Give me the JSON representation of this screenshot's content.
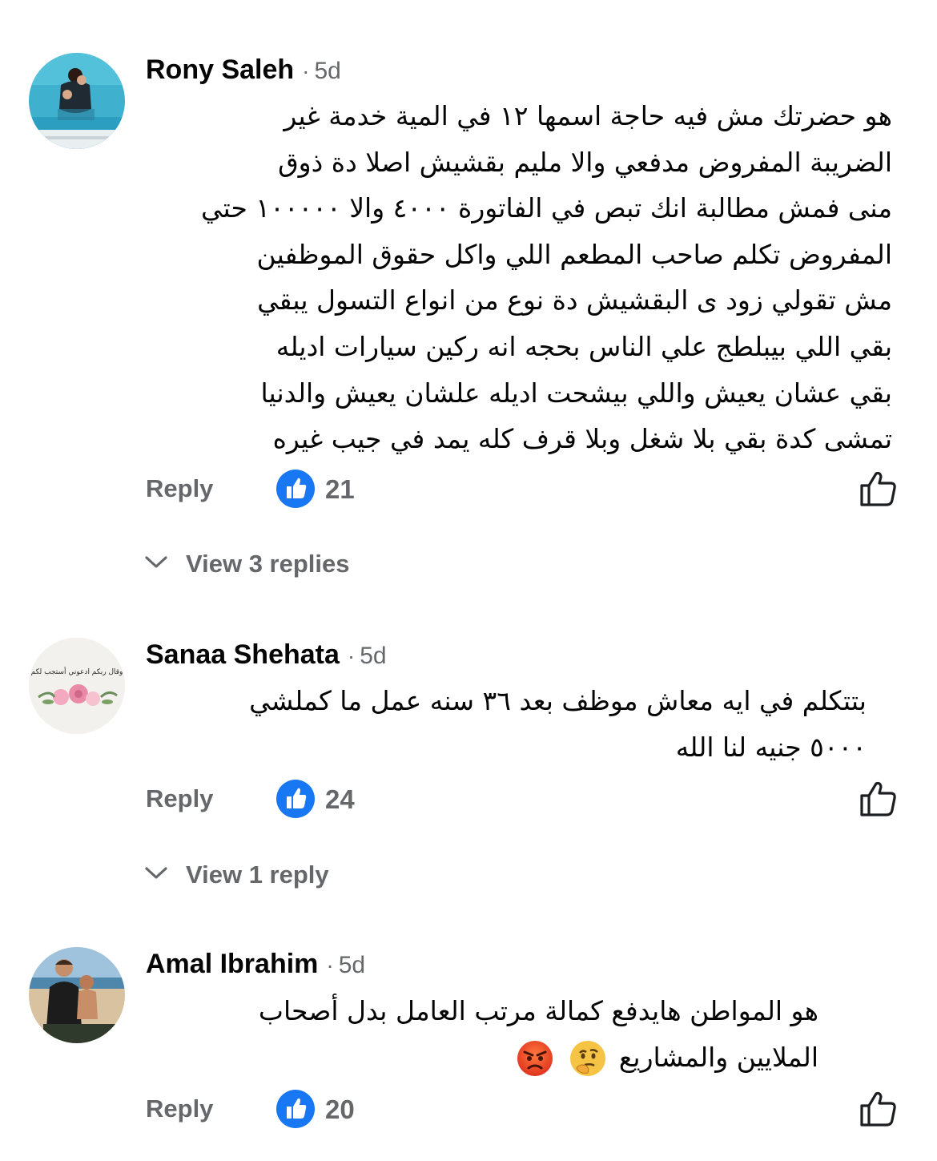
{
  "comments": [
    {
      "author": "Rony Saleh",
      "time": "5d",
      "lines": [
        "هو حضرتك مش فيه حاجة اسمها ١٢ في المية خدمة غير",
        "الضريبة المفروض مدفعي والا مليم بقشيش اصلا دة ذوق",
        "منى فمش مطالبة انك تبص في الفاتورة ٤٠٠٠ والا ١٠٠٠٠٠ حتي",
        "المفروض تكلم صاحب المطعم اللي واكل حقوق الموظفين",
        "مش تقولي زود ى البقشيش دة نوع من انواع التسول يبقي",
        "بقي اللي بيبلطج علي الناس بحجه انه ركين سيارات اديله",
        "بقي عشان يعيش واللي بيشحت اديله علشان يعيش والدنيا",
        "تمشى كدة بقي بلا شغل وبلا قرف كله يمد في جيب غيره"
      ],
      "reply_label": "Reply",
      "likes": "21",
      "view_replies": "View 3 replies"
    },
    {
      "author": "Sanaa Shehata",
      "time": "5d",
      "lines": [
        "بتتكلم في ايه معاش موظف بعد ٣٦ سنه عمل ما كملشي",
        "٥٠٠٠ جنيه لنا الله"
      ],
      "avatar_text": "وقال ربكم ادعوني أستجب لكم",
      "reply_label": "Reply",
      "likes": "24",
      "view_replies": "View 1 reply"
    },
    {
      "author": "Amal Ibrahim",
      "time": "5d",
      "lines": [
        "هو المواطن هايدفع كمالة مرتب العامل بدل أصحاب",
        "الملايين والمشاريع"
      ],
      "emojis": [
        "thinking-face",
        "angry-face"
      ],
      "reply_label": "Reply",
      "likes": "20"
    }
  ],
  "separator": "·",
  "colors": {
    "like_blue": "#1877f2",
    "secondary_text": "#65676b",
    "primary_text": "#050505"
  }
}
